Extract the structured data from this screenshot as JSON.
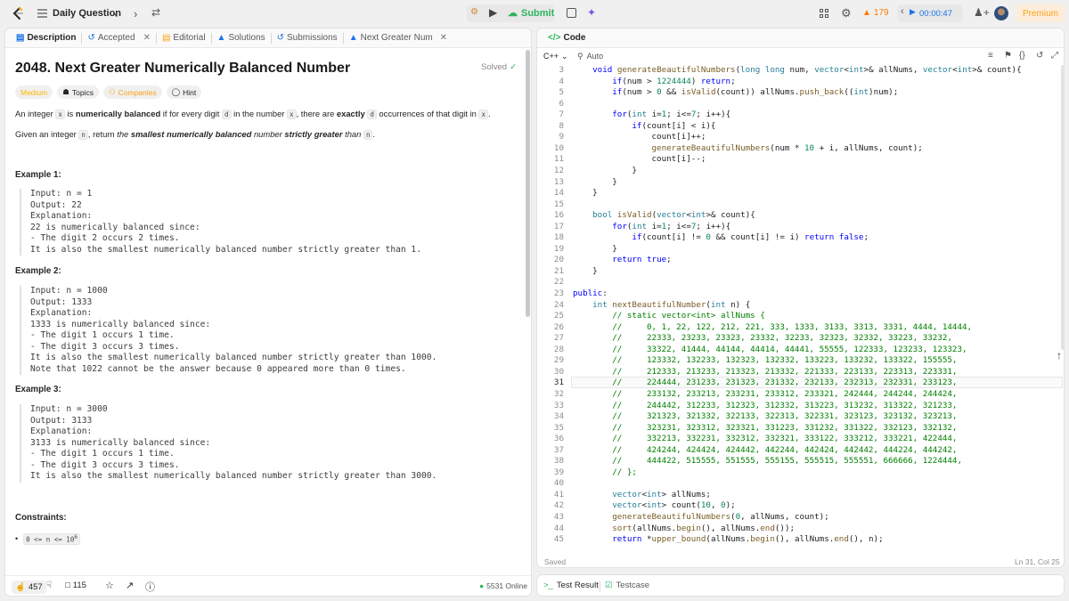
{
  "topbar": {
    "nav_title": "Daily Question",
    "submit": "Submit",
    "streak": "179",
    "timer": "00:00:47",
    "premium": "Premium"
  },
  "tabs": [
    {
      "label": "Description"
    },
    {
      "label": "Accepted"
    },
    {
      "label": "Editorial"
    },
    {
      "label": "Solutions"
    },
    {
      "label": "Submissions"
    },
    {
      "label": "Next Greater Numer"
    }
  ],
  "problem": {
    "title": "2048. Next Greater Numerically Balanced Number",
    "status": "Solved",
    "difficulty": "Medium",
    "tags": [
      "Topics",
      "Companies",
      "Hint"
    ],
    "desc1_a": "An integer ",
    "desc1_x": "x",
    "desc1_b": " is ",
    "desc1_c": "numerically balanced",
    "desc1_d": " if for every digit ",
    "desc1_e": "d",
    "desc1_f": " in the number ",
    "desc1_g": "x",
    "desc1_h": ", there are ",
    "desc1_i": "exactly",
    "desc1_j": " ",
    "desc1_k": "d",
    "desc1_l": " occurrences of that digit in ",
    "desc1_m": "x",
    "desc1_n": ".",
    "desc2_a": "Given an integer ",
    "desc2_b": "n",
    "desc2_c": ", return ",
    "desc2_d": "the ",
    "desc2_e": "smallest numerically balanced",
    "desc2_f": " number ",
    "desc2_g": "strictly greater",
    "desc2_h": " than ",
    "desc2_i": "n",
    "desc2_j": ".",
    "examples": [
      {
        "title": "Example 1:",
        "body": "Input: n = 1\nOutput: 22\nExplanation:\n22 is numerically balanced since:\n- The digit 2 occurs 2 times.\nIt is also the smallest numerically balanced number strictly greater than 1."
      },
      {
        "title": "Example 2:",
        "body": "Input: n = 1000\nOutput: 1333\nExplanation:\n1333 is numerically balanced since:\n- The digit 1 occurs 1 time.\n- The digit 3 occurs 3 times.\nIt is also the smallest numerically balanced number strictly greater than 1000.\nNote that 1022 cannot be the answer because 0 appeared more than 0 times."
      },
      {
        "title": "Example 3:",
        "body": "Input: n = 3000\nOutput: 3133\nExplanation:\n3133 is numerically balanced since:\n- The digit 1 occurs 1 time.\n- The digit 3 occurs 3 times.\nIt is also the smallest numerically balanced number strictly greater than 3000."
      }
    ],
    "constraints_title": "Constraints:",
    "constraint": "0 <= n <= 10",
    "constraint_exp": "6"
  },
  "footer": {
    "likes": "457",
    "comments": "115",
    "online": "5531 Online"
  },
  "editor": {
    "header": "Code",
    "language": "C++",
    "auto": "Auto",
    "saved": "Saved",
    "cursor": "Ln 31, Col 25",
    "active_line": 31,
    "lines": [
      {
        "n": "3",
        "t": "    void generateBeautifulNumbers(long long num, vector<int>& allNums, vector<int>& count){"
      },
      {
        "n": "4",
        "t": "        if(num > 1224444) return;"
      },
      {
        "n": "5",
        "t": "        if(num > 0 && isValid(count)) allNums.push_back((int)num);"
      },
      {
        "n": "6",
        "t": ""
      },
      {
        "n": "7",
        "t": "        for(int i=1; i<=7; i++){"
      },
      {
        "n": "8",
        "t": "            if(count[i] < i){"
      },
      {
        "n": "9",
        "t": "                count[i]++;"
      },
      {
        "n": "10",
        "t": "                generateBeautifulNumbers(num * 10 + i, allNums, count);"
      },
      {
        "n": "11",
        "t": "                count[i]--;"
      },
      {
        "n": "12",
        "t": "            }"
      },
      {
        "n": "13",
        "t": "        }"
      },
      {
        "n": "14",
        "t": "    }"
      },
      {
        "n": "15",
        "t": ""
      },
      {
        "n": "16",
        "t": "    bool isValid(vector<int>& count){"
      },
      {
        "n": "17",
        "t": "        for(int i=1; i<=7; i++){"
      },
      {
        "n": "18",
        "t": "            if(count[i] != 0 && count[i] != i) return false;"
      },
      {
        "n": "19",
        "t": "        }"
      },
      {
        "n": "20",
        "t": "        return true;"
      },
      {
        "n": "21",
        "t": "    }"
      },
      {
        "n": "22",
        "t": ""
      },
      {
        "n": "23",
        "t": "public:"
      },
      {
        "n": "24",
        "t": "    int nextBeautifulNumber(int n) {"
      },
      {
        "n": "25",
        "t": "        // static vector<int> allNums {"
      },
      {
        "n": "26",
        "t": "        //     0, 1, 22, 122, 212, 221, 333, 1333, 3133, 3313, 3331, 4444, 14444,"
      },
      {
        "n": "27",
        "t": "        //     22333, 23233, 23323, 23332, 32233, 32323, 32332, 33223, 33232,"
      },
      {
        "n": "28",
        "t": "        //     33322, 41444, 44144, 44414, 44441, 55555, 122333, 123233, 123323,"
      },
      {
        "n": "29",
        "t": "        //     123332, 132233, 132323, 132332, 133223, 133232, 133322, 155555,"
      },
      {
        "n": "30",
        "t": "        //     212333, 213233, 213323, 213332, 221333, 223133, 223313, 223331,"
      },
      {
        "n": "31",
        "t": "        //     224444, 231233, 231323, 231332, 232133, 232313, 232331, 233123,"
      },
      {
        "n": "32",
        "t": "        //     233132, 233213, 233231, 233312, 233321, 242444, 244244, 244424,"
      },
      {
        "n": "33",
        "t": "        //     244442, 312233, 312323, 312332, 313223, 313232, 313322, 321233,"
      },
      {
        "n": "34",
        "t": "        //     321323, 321332, 322133, 322313, 322331, 323123, 323132, 323213,"
      },
      {
        "n": "35",
        "t": "        //     323231, 323312, 323321, 331223, 331232, 331322, 332123, 332132,"
      },
      {
        "n": "36",
        "t": "        //     332213, 332231, 332312, 332321, 333122, 333212, 333221, 422444,"
      },
      {
        "n": "37",
        "t": "        //     424244, 424424, 424442, 442244, 442424, 442442, 444224, 444242,"
      },
      {
        "n": "38",
        "t": "        //     444422, 515555, 551555, 555155, 555515, 555551, 666666, 1224444,"
      },
      {
        "n": "39",
        "t": "        // };"
      },
      {
        "n": "40",
        "t": ""
      },
      {
        "n": "41",
        "t": "        vector<int> allNums;"
      },
      {
        "n": "42",
        "t": "        vector<int> count(10, 0);"
      },
      {
        "n": "43",
        "t": "        generateBeautifulNumbers(0, allNums, count);"
      },
      {
        "n": "44",
        "t": "        sort(allNums.begin(), allNums.end());"
      },
      {
        "n": "45",
        "t": "        return *upper_bound(allNums.begin(), allNums.end(), n);"
      }
    ]
  },
  "bottom": {
    "test_result": "Test Result",
    "testcase": "Testcase"
  },
  "colors": {
    "accent": "#ffa116",
    "green": "#2db55d",
    "medium": "#ffb800"
  }
}
